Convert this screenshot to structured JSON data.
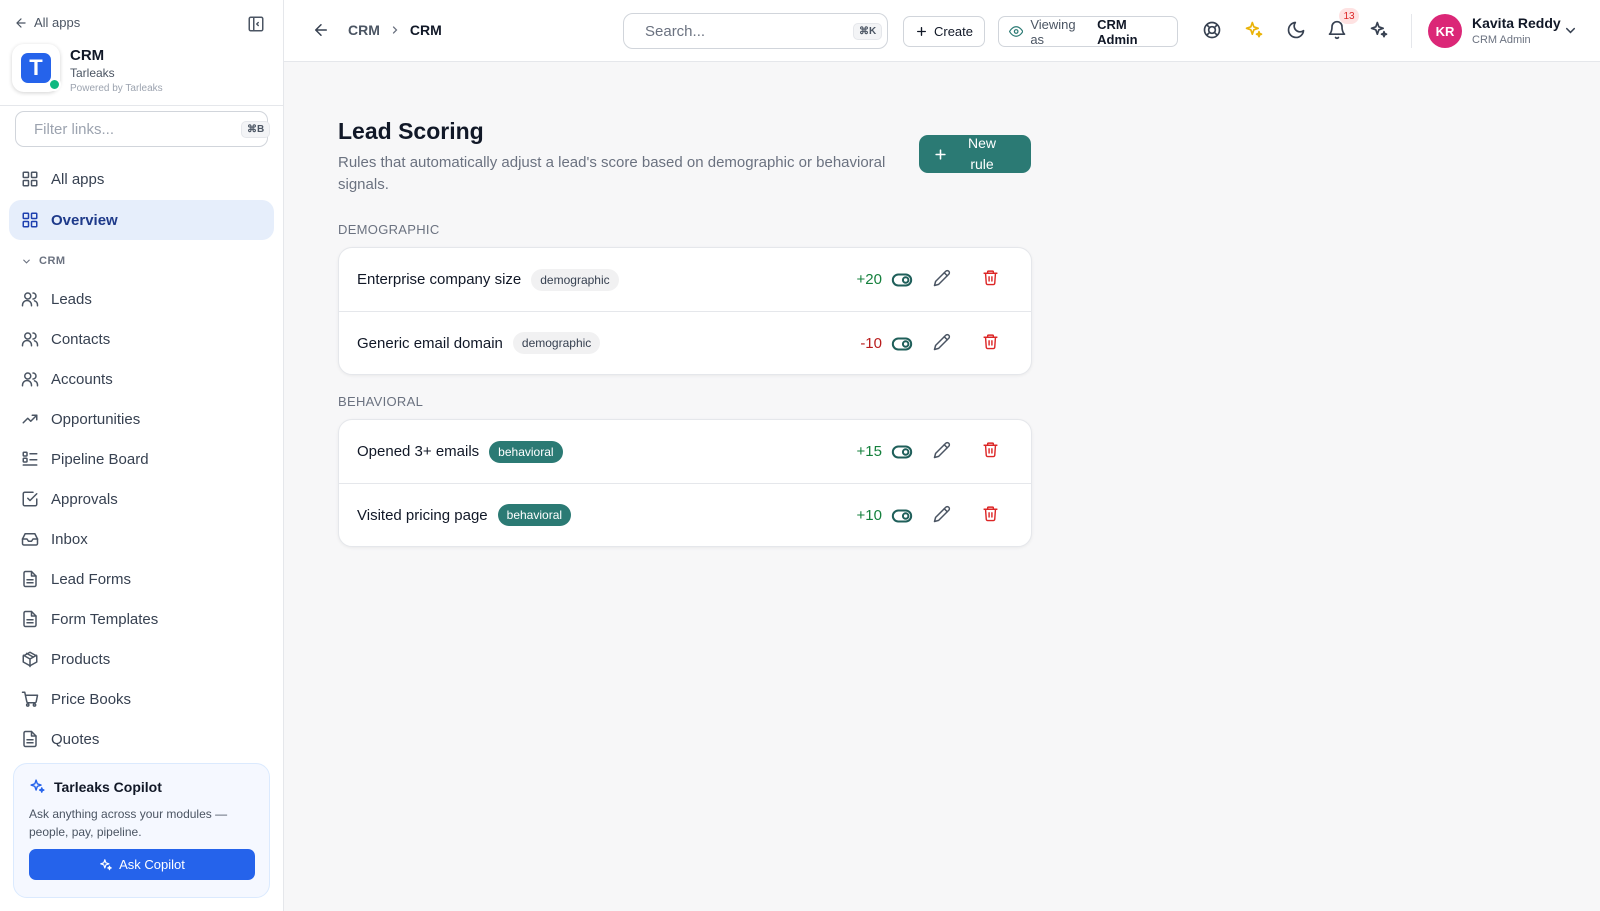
{
  "sidebar": {
    "back_label": "All apps",
    "brand": {
      "logo_letter": "T",
      "name": "CRM",
      "org": "Tarleaks",
      "powered": "Powered by Tarleaks"
    },
    "filter": {
      "placeholder": "Filter links...",
      "shortcut": "⌘B"
    },
    "top_items": [
      {
        "label": "All apps",
        "icon": "grid-icon"
      },
      {
        "label": "Overview",
        "icon": "grid-icon",
        "active": true
      }
    ],
    "section_label": "CRM",
    "items": [
      {
        "label": "Leads",
        "icon": "users-icon"
      },
      {
        "label": "Contacts",
        "icon": "users-icon"
      },
      {
        "label": "Accounts",
        "icon": "users-icon"
      },
      {
        "label": "Opportunities",
        "icon": "trending-up-icon"
      },
      {
        "label": "Pipeline Board",
        "icon": "list-icon"
      },
      {
        "label": "Approvals",
        "icon": "check-square-icon"
      },
      {
        "label": "Inbox",
        "icon": "inbox-icon"
      },
      {
        "label": "Lead Forms",
        "icon": "file-icon"
      },
      {
        "label": "Form Templates",
        "icon": "file-icon"
      },
      {
        "label": "Products",
        "icon": "package-icon"
      },
      {
        "label": "Price Books",
        "icon": "cart-icon"
      },
      {
        "label": "Quotes",
        "icon": "file-icon"
      }
    ],
    "copilot": {
      "title": "Tarleaks Copilot",
      "description": "Ask anything across your modules — people, pay, pipeline.",
      "button": "Ask Copilot"
    }
  },
  "topbar": {
    "breadcrumb": [
      "CRM",
      "CRM"
    ],
    "search": {
      "placeholder": "Search...",
      "shortcut": "⌘K"
    },
    "create_label": "Create",
    "viewing_prefix": "Viewing as",
    "viewing_role": "CRM Admin",
    "notifications_count": "13",
    "user": {
      "initials": "KR",
      "name": "Kavita Reddy",
      "role": "CRM Admin"
    }
  },
  "page": {
    "title": "Lead Scoring",
    "subtitle": "Rules that automatically adjust a lead's score based on demographic or behavioral signals.",
    "new_rule_label": "New rule",
    "sections": [
      {
        "heading": "DEMOGRAPHIC",
        "rules": [
          {
            "name": "Enterprise company size",
            "tag": "demographic",
            "score": "+20",
            "enabled": true
          },
          {
            "name": "Generic email domain",
            "tag": "demographic",
            "score": "-10",
            "enabled": true
          }
        ]
      },
      {
        "heading": "BEHAVIORAL",
        "rules": [
          {
            "name": "Opened 3+ emails",
            "tag": "behavioral",
            "score": "+15",
            "enabled": true
          },
          {
            "name": "Visited pricing page",
            "tag": "behavioral",
            "score": "+10",
            "enabled": true
          }
        ]
      }
    ]
  },
  "colors": {
    "accent_teal": "#2b7a74",
    "primary_blue": "#2563eb",
    "positive": "#15803d",
    "negative": "#b91c1c",
    "avatar": "#db2777"
  }
}
